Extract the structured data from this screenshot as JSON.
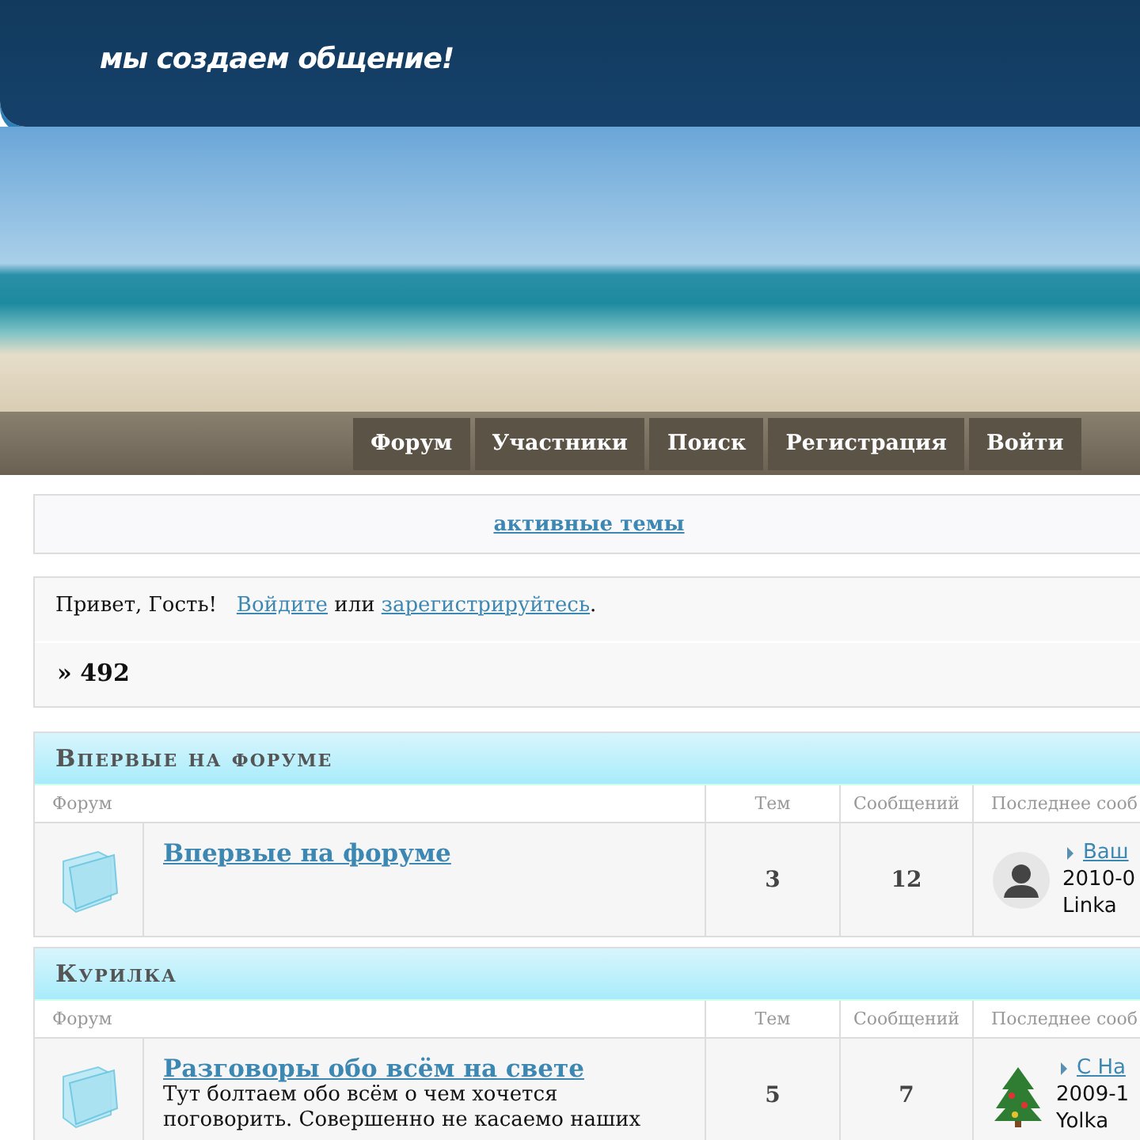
{
  "header": {
    "slogan": "мы создаем общение!"
  },
  "nav": [
    {
      "label": "Форум"
    },
    {
      "label": "Участники"
    },
    {
      "label": "Поиск"
    },
    {
      "label": "Регистрация"
    },
    {
      "label": "Войти"
    }
  ],
  "active_topics_link": "активные темы",
  "welcome": {
    "greeting": "Привет, Гость!",
    "login_link": "Войдите",
    "joiner": "или",
    "register_link": "зарегистрируйтесь",
    "end": "."
  },
  "stats": "» 492",
  "categories": [
    {
      "title": "Впервые на форуме",
      "columns": [
        "Форум",
        "Тем",
        "Сообщений",
        "Последнее сооб"
      ],
      "forums": [
        {
          "name": "Впервые на форуме",
          "topics": "3",
          "posts": "12",
          "last_post": {
            "kind": "person",
            "title": "Ваш",
            "date": "2010-0",
            "author": "Linka"
          }
        }
      ]
    },
    {
      "title": "Курилка",
      "columns": [
        "Форум",
        "Тем",
        "Сообщений",
        "Последнее сооб"
      ],
      "forums": [
        {
          "name": "Разговоры обо всём на свете",
          "description": "Тут болтаем обо всём о чем хочется поговорить. Совершенно не касаемо наших",
          "topics": "5",
          "posts": "7",
          "last_post": {
            "kind": "tree",
            "title": "С На",
            "date": "2009-1",
            "author": "Yolka"
          }
        }
      ]
    }
  ]
}
